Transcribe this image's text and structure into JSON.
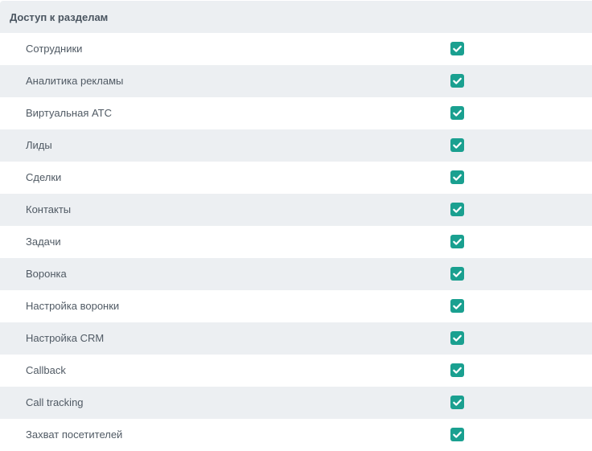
{
  "section": {
    "title": "Доступ к разделам"
  },
  "colors": {
    "checkbox_fill": "#1aa090",
    "row_shade": "#eceff2",
    "text": "#505a64"
  },
  "items": [
    {
      "label": "Сотрудники",
      "checked": true
    },
    {
      "label": "Аналитика рекламы",
      "checked": true
    },
    {
      "label": "Виртуальная АТС",
      "checked": true
    },
    {
      "label": "Лиды",
      "checked": true
    },
    {
      "label": "Сделки",
      "checked": true
    },
    {
      "label": "Контакты",
      "checked": true
    },
    {
      "label": "Задачи",
      "checked": true
    },
    {
      "label": "Воронка",
      "checked": true
    },
    {
      "label": "Настройка воронки",
      "checked": true
    },
    {
      "label": "Настройка CRM",
      "checked": true
    },
    {
      "label": "Callback",
      "checked": true
    },
    {
      "label": "Call tracking",
      "checked": true
    },
    {
      "label": "Захват посетителей",
      "checked": true
    }
  ]
}
